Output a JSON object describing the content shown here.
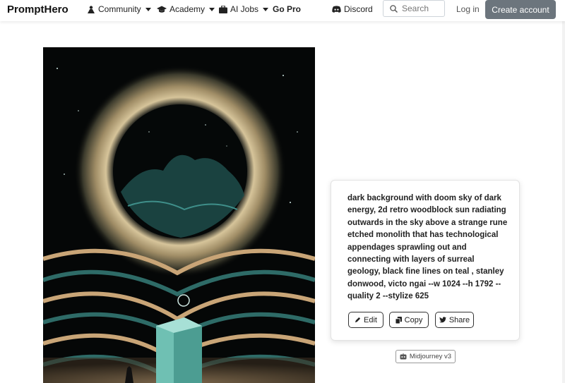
{
  "nav": {
    "brand": "PromptHero",
    "items": [
      {
        "label": "Community",
        "icon": "community-icon"
      },
      {
        "label": "Academy",
        "icon": "graduation-cap-icon"
      },
      {
        "label": "AI Jobs",
        "icon": "briefcase-icon"
      },
      {
        "label": "Go Pro"
      }
    ],
    "discord": "Discord",
    "search_placeholder": "Search",
    "login": "Log in",
    "create_account": "Create account"
  },
  "image": {
    "icon": "generated-artwork",
    "colors": {
      "background": "#050707",
      "glow": "#c8b58a",
      "teal": "#3f8f8a",
      "sand": "#c9a577"
    }
  },
  "prompt_card": {
    "text": "dark background with doom sky of dark energy, 2d retro woodblock sun radiating outwards in the sky above a strange rune etched monolith that has technological appendages sprawling out and connecting with layers of surreal geology, black fine lines on teal , stanley donwood, victo ngai --w 1024 --h 1792 --quality 2 --stylize 625",
    "buttons": {
      "edit": "Edit",
      "copy": "Copy",
      "share": "Share"
    }
  },
  "model_badge": "Midjourney v3",
  "colors": {
    "create_button": "#6c757d",
    "text": "#212529"
  }
}
